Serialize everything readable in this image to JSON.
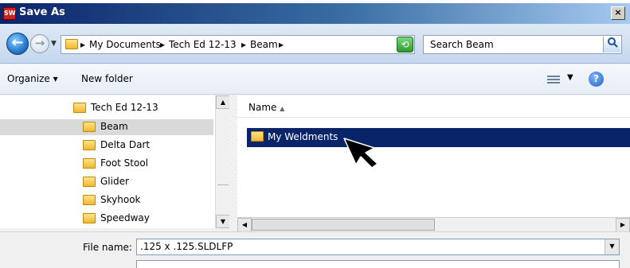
{
  "window": {
    "title": "Save As",
    "app_icon_text": "SW",
    "close_glyph": "×"
  },
  "navbar": {
    "back_glyph": "←",
    "forward_glyph": "→",
    "dropdown_glyph": "▼",
    "breadcrumbs": [
      "My Documents",
      "Tech Ed 12-13",
      "Beam"
    ],
    "crumb_separator_glyph": "▸",
    "refresh_glyph": "⟲",
    "search_placeholder": "Search Beam",
    "search_icon": "magnifier-icon"
  },
  "toolbar": {
    "organize": "Organize ▾",
    "new_folder": "New folder",
    "view_dropdown": "▼",
    "help": "?"
  },
  "nav_tree": [
    {
      "label": "Tech Ed 12-13",
      "selected": false
    },
    {
      "label": "Beam",
      "selected": true
    },
    {
      "label": "Delta Dart",
      "selected": false
    },
    {
      "label": "Foot Stool",
      "selected": false
    },
    {
      "label": "Glider",
      "selected": false
    },
    {
      "label": "Skyhook",
      "selected": false
    },
    {
      "label": "Speedway",
      "selected": false
    }
  ],
  "content": {
    "column_name": "Name",
    "sort_glyph": "▲",
    "items": [
      {
        "label": "My Weldments",
        "selected": true
      }
    ]
  },
  "bottom": {
    "file_name_label": "File name:",
    "file_name_value": ".125 x .125.SLDLFP"
  },
  "colors": {
    "title_bar": "#0a246a",
    "selection": "#0a246a",
    "folder": "#f0b830"
  }
}
